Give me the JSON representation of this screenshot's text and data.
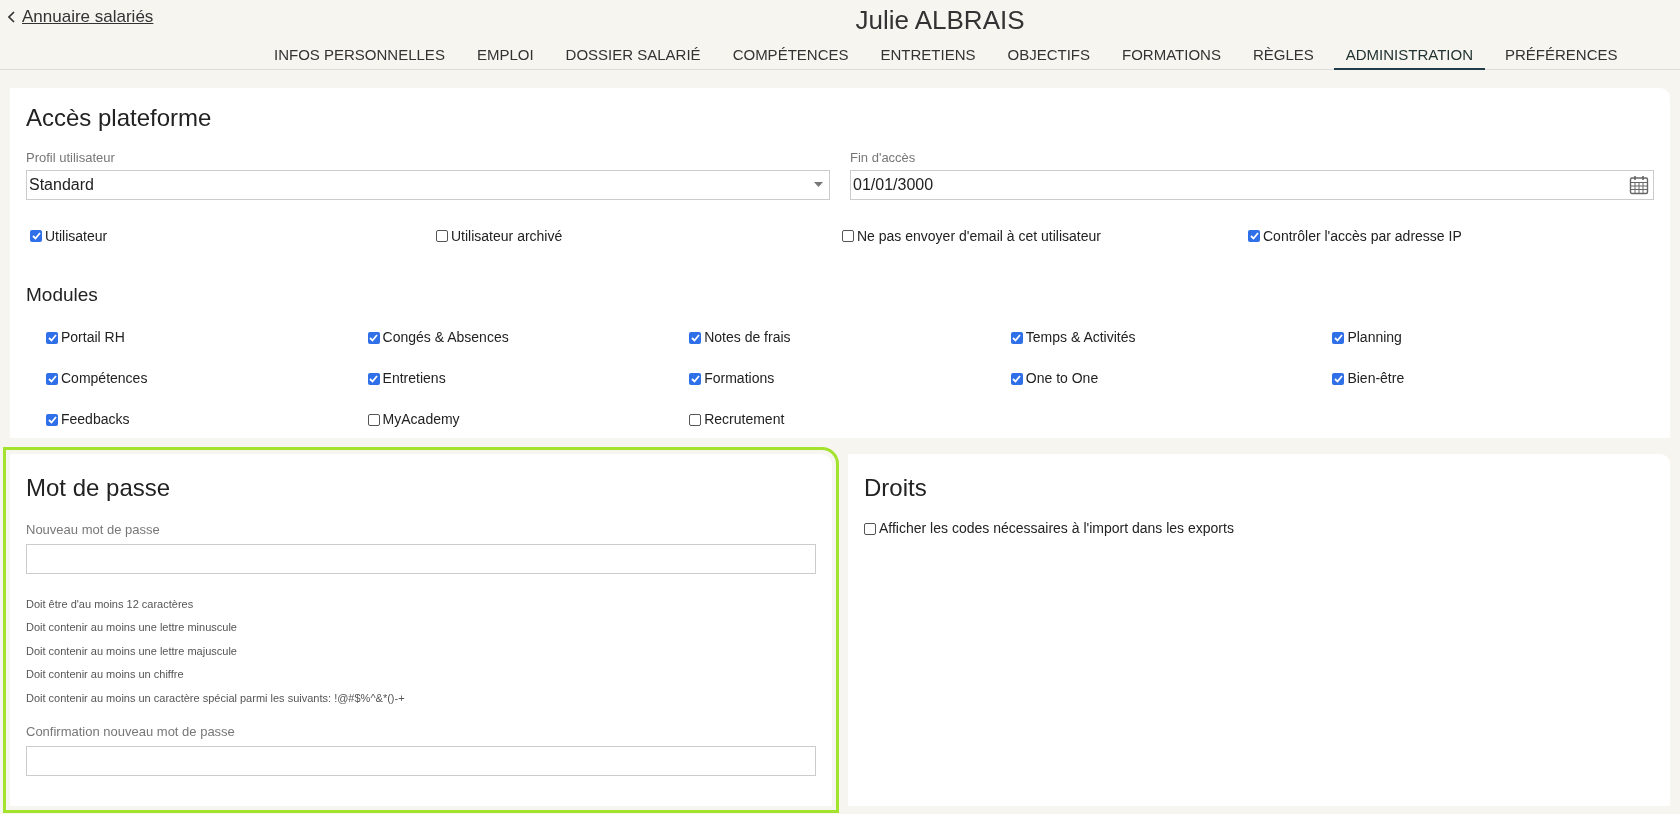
{
  "back_link": {
    "label": "Annuaire salariés"
  },
  "title": "Julie ALBRAIS",
  "tabs": [
    {
      "label": "INFOS PERSONNELLES",
      "selected": false
    },
    {
      "label": "EMPLOI",
      "selected": false
    },
    {
      "label": "DOSSIER SALARIÉ",
      "selected": false
    },
    {
      "label": "COMPÉTENCES",
      "selected": false
    },
    {
      "label": "ENTRETIENS",
      "selected": false
    },
    {
      "label": "OBJECTIFS",
      "selected": false
    },
    {
      "label": "FORMATIONS",
      "selected": false
    },
    {
      "label": "RÈGLES",
      "selected": false
    },
    {
      "label": "ADMINISTRATION",
      "selected": true
    },
    {
      "label": "PRÉFÉRENCES",
      "selected": false
    }
  ],
  "access": {
    "title": "Accès plateforme",
    "profile": {
      "label": "Profil utilisateur",
      "value": "Standard"
    },
    "end_date": {
      "label": "Fin d'accès",
      "value": "01/01/3000"
    },
    "options": [
      {
        "label": "Utilisateur",
        "checked": true
      },
      {
        "label": "Utilisateur archivé",
        "checked": false
      },
      {
        "label": "Ne pas envoyer d'email à cet utilisateur",
        "checked": false
      },
      {
        "label": "Contrôler l'accès par adresse IP",
        "checked": true
      }
    ],
    "modules_title": "Modules",
    "modules": [
      {
        "label": "Portail RH",
        "checked": true
      },
      {
        "label": "Congés & Absences",
        "checked": true
      },
      {
        "label": "Notes de frais",
        "checked": true
      },
      {
        "label": "Temps & Activités",
        "checked": true
      },
      {
        "label": "Planning",
        "checked": true
      },
      {
        "label": "Compétences",
        "checked": true
      },
      {
        "label": "Entretiens",
        "checked": true
      },
      {
        "label": "Formations",
        "checked": true
      },
      {
        "label": "One to One",
        "checked": true
      },
      {
        "label": "Bien-être",
        "checked": true
      },
      {
        "label": "Feedbacks",
        "checked": true
      },
      {
        "label": "MyAcademy",
        "checked": false
      },
      {
        "label": "Recrutement",
        "checked": false
      }
    ]
  },
  "password": {
    "title": "Mot de passe",
    "highlighted": true,
    "new_label": "Nouveau mot de passe",
    "rules": [
      "Doit être d'au moins 12 caractères",
      "Doit contenir au moins une lettre minuscule",
      "Doit contenir au moins une lettre majuscule",
      "Doit contenir au moins un chiffre",
      "Doit contenir au moins un caractère spécial parmi les suivants: !@#$%^&*()-+"
    ],
    "confirm_label": "Confirmation nouveau mot de passe"
  },
  "rights": {
    "title": "Droits",
    "options": [
      {
        "label": "Afficher les codes nécessaires à l'import dans les exports",
        "checked": false
      }
    ]
  }
}
